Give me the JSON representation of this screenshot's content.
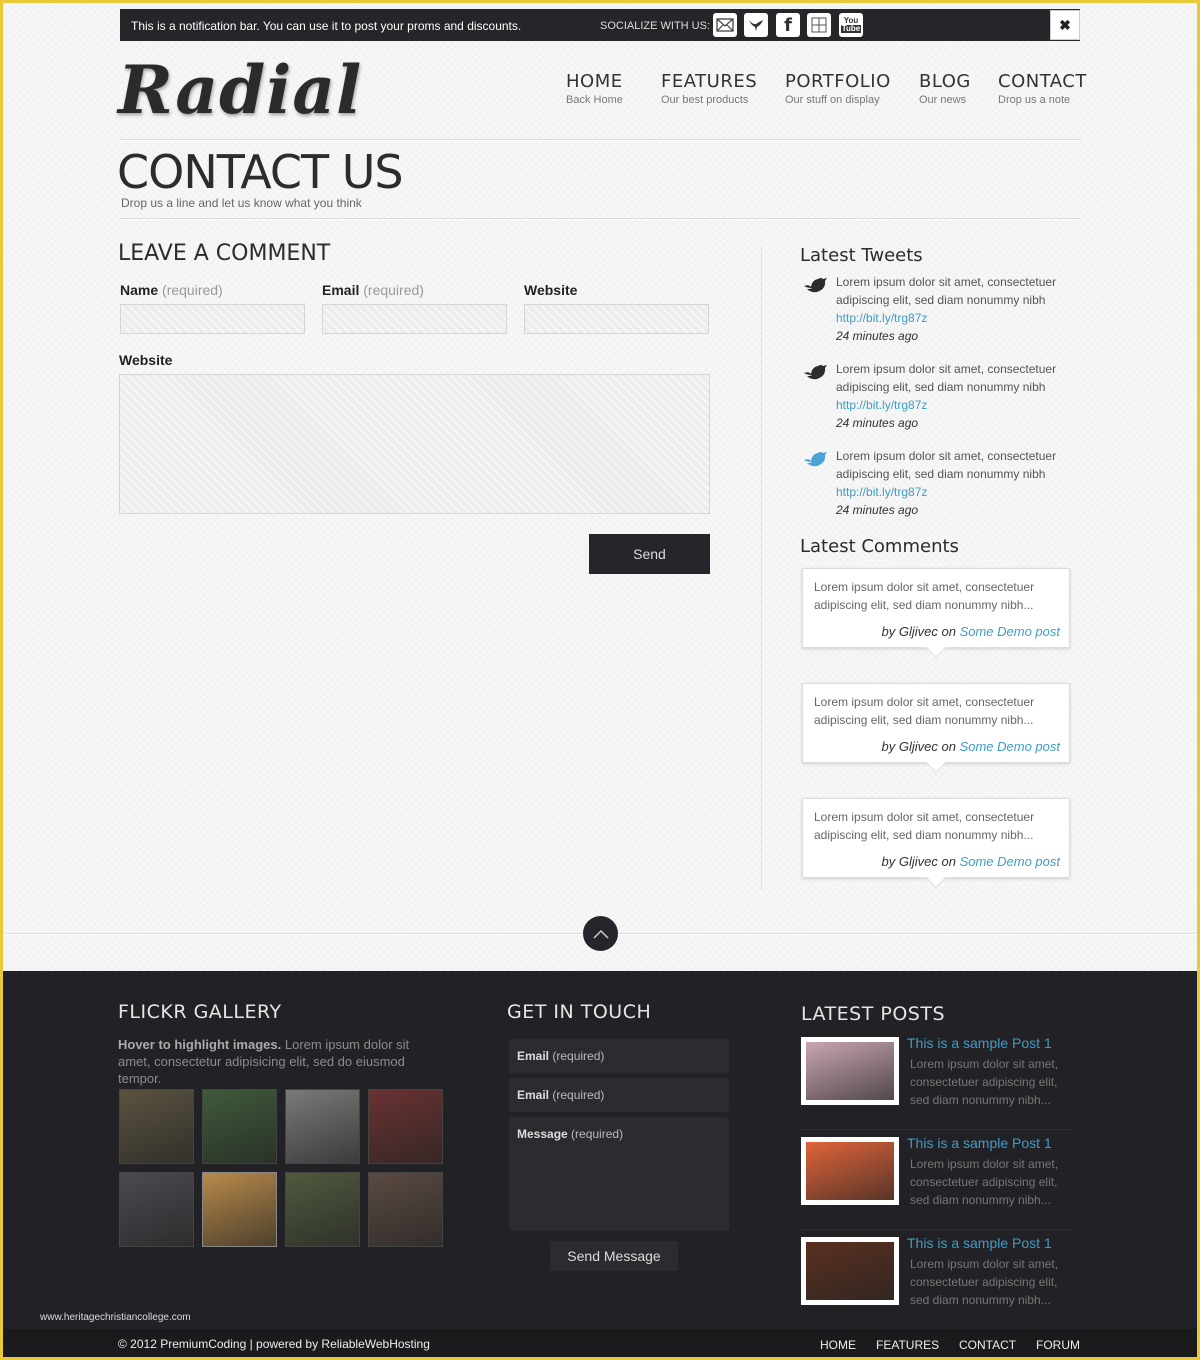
{
  "notification": {
    "message": "This is a notification bar. You can use it to post your proms and discounts.",
    "socialize_label": "SOCIALIZE WITH US:",
    "social_icons": [
      "email-icon",
      "twitter-icon",
      "facebook-icon",
      "delicious-icon",
      "youtube-icon"
    ],
    "close_symbol": "✖"
  },
  "header": {
    "logo": "Radial",
    "nav": [
      {
        "title": "HOME",
        "subtitle": "Back Home"
      },
      {
        "title": "FEATURES",
        "subtitle": "Our best products"
      },
      {
        "title": "PORTFOLIO",
        "subtitle": "Our stuff on display"
      },
      {
        "title": "BLOG",
        "subtitle": "Our news"
      },
      {
        "title": "CONTACT",
        "subtitle": "Drop us a note"
      }
    ]
  },
  "page": {
    "title": "CONTACT US",
    "subtitle": "Drop us a line and let us know what you think"
  },
  "form": {
    "heading": "LEAVE A COMMENT",
    "fields": [
      {
        "label": "Name",
        "hint": "(required)",
        "value": ""
      },
      {
        "label": "Email",
        "hint": "(required)",
        "value": ""
      },
      {
        "label": "Website",
        "hint": "",
        "value": ""
      }
    ],
    "message_label": "Website",
    "message_value": "",
    "send_label": "Send"
  },
  "sidebar": {
    "tweets_heading": "Latest Tweets",
    "tweets": [
      {
        "text": "Lorem ipsum dolor sit amet, consectetuer adipiscing elit, sed diam nonummy nibh",
        "link": "http://bit.ly/trg87z",
        "time": "24 minutes ago"
      },
      {
        "text": "Lorem ipsum dolor sit amet, consectetuer adipiscing elit, sed diam nonummy nibh",
        "link": "http://bit.ly/trg87z",
        "time": "24 minutes ago"
      },
      {
        "text": "Lorem ipsum dolor sit amet, consectetuer adipiscing elit, sed diam nonummy nibh",
        "link": "http://bit.ly/trg87z",
        "time": "24 minutes ago"
      }
    ],
    "comments_heading": "Latest Comments",
    "comments": [
      {
        "text": "Lorem ipsum dolor sit amet, consectetuer adipiscing elit, sed diam nonummy nibh...",
        "by": "by Gljivec on",
        "post": "Some Demo post"
      },
      {
        "text": "Lorem ipsum dolor sit amet, consectetuer adipiscing elit, sed diam nonummy nibh...",
        "by": "by Gljivec on",
        "post": "Some Demo post"
      },
      {
        "text": "Lorem ipsum dolor sit amet, consectetuer adipiscing elit, sed diam nonummy nibh...",
        "by": "by Gljivec on",
        "post": "Some Demo post"
      }
    ]
  },
  "footer": {
    "flickr": {
      "heading": "FLICKR GALLERY",
      "desc_bold": "Hover to highlight images.",
      "desc": " Lorem ipsum dolor sit amet, consectetur adipisicing elit, sed do eiusmod tempor.",
      "thumbs": [
        "#5a5340",
        "#3f5a3a",
        "#7a7a78",
        "#6a3232",
        "#4a4a50",
        "#b88a4a",
        "#4f5a3e",
        "#5a4a42"
      ]
    },
    "contact": {
      "heading": "GET IN TOUCH",
      "fields": [
        {
          "label": "Email",
          "hint": "(required)"
        },
        {
          "label": "Email",
          "hint": "(required)"
        },
        {
          "label": "Message",
          "hint": "(required)"
        }
      ],
      "send_label": "Send Message"
    },
    "posts": {
      "heading": "LATEST POSTS",
      "items": [
        {
          "title": "This is a sample Post 1",
          "desc": "Lorem ipsum dolor sit amet, consectetuer adipiscing elit, sed diam nonummy nibh...",
          "color": "#c9a6b0"
        },
        {
          "title": "This is a sample Post 1",
          "desc": "Lorem ipsum dolor sit amet, consectetuer adipiscing elit, sed diam nonummy nibh...",
          "color": "#e0643a"
        },
        {
          "title": "This is a sample Post 1",
          "desc": "Lorem ipsum dolor sit amet, consectetuer adipiscing elit, sed diam nonummy nibh...",
          "color": "#5a3020"
        }
      ]
    },
    "watermark": "www.heritagechristiancollege.com",
    "copyright": "© 2012 PremiumCoding | powered by ReliableWebHosting",
    "nav": [
      "HOME",
      "FEATURES",
      "CONTACT",
      "FORUM"
    ]
  }
}
